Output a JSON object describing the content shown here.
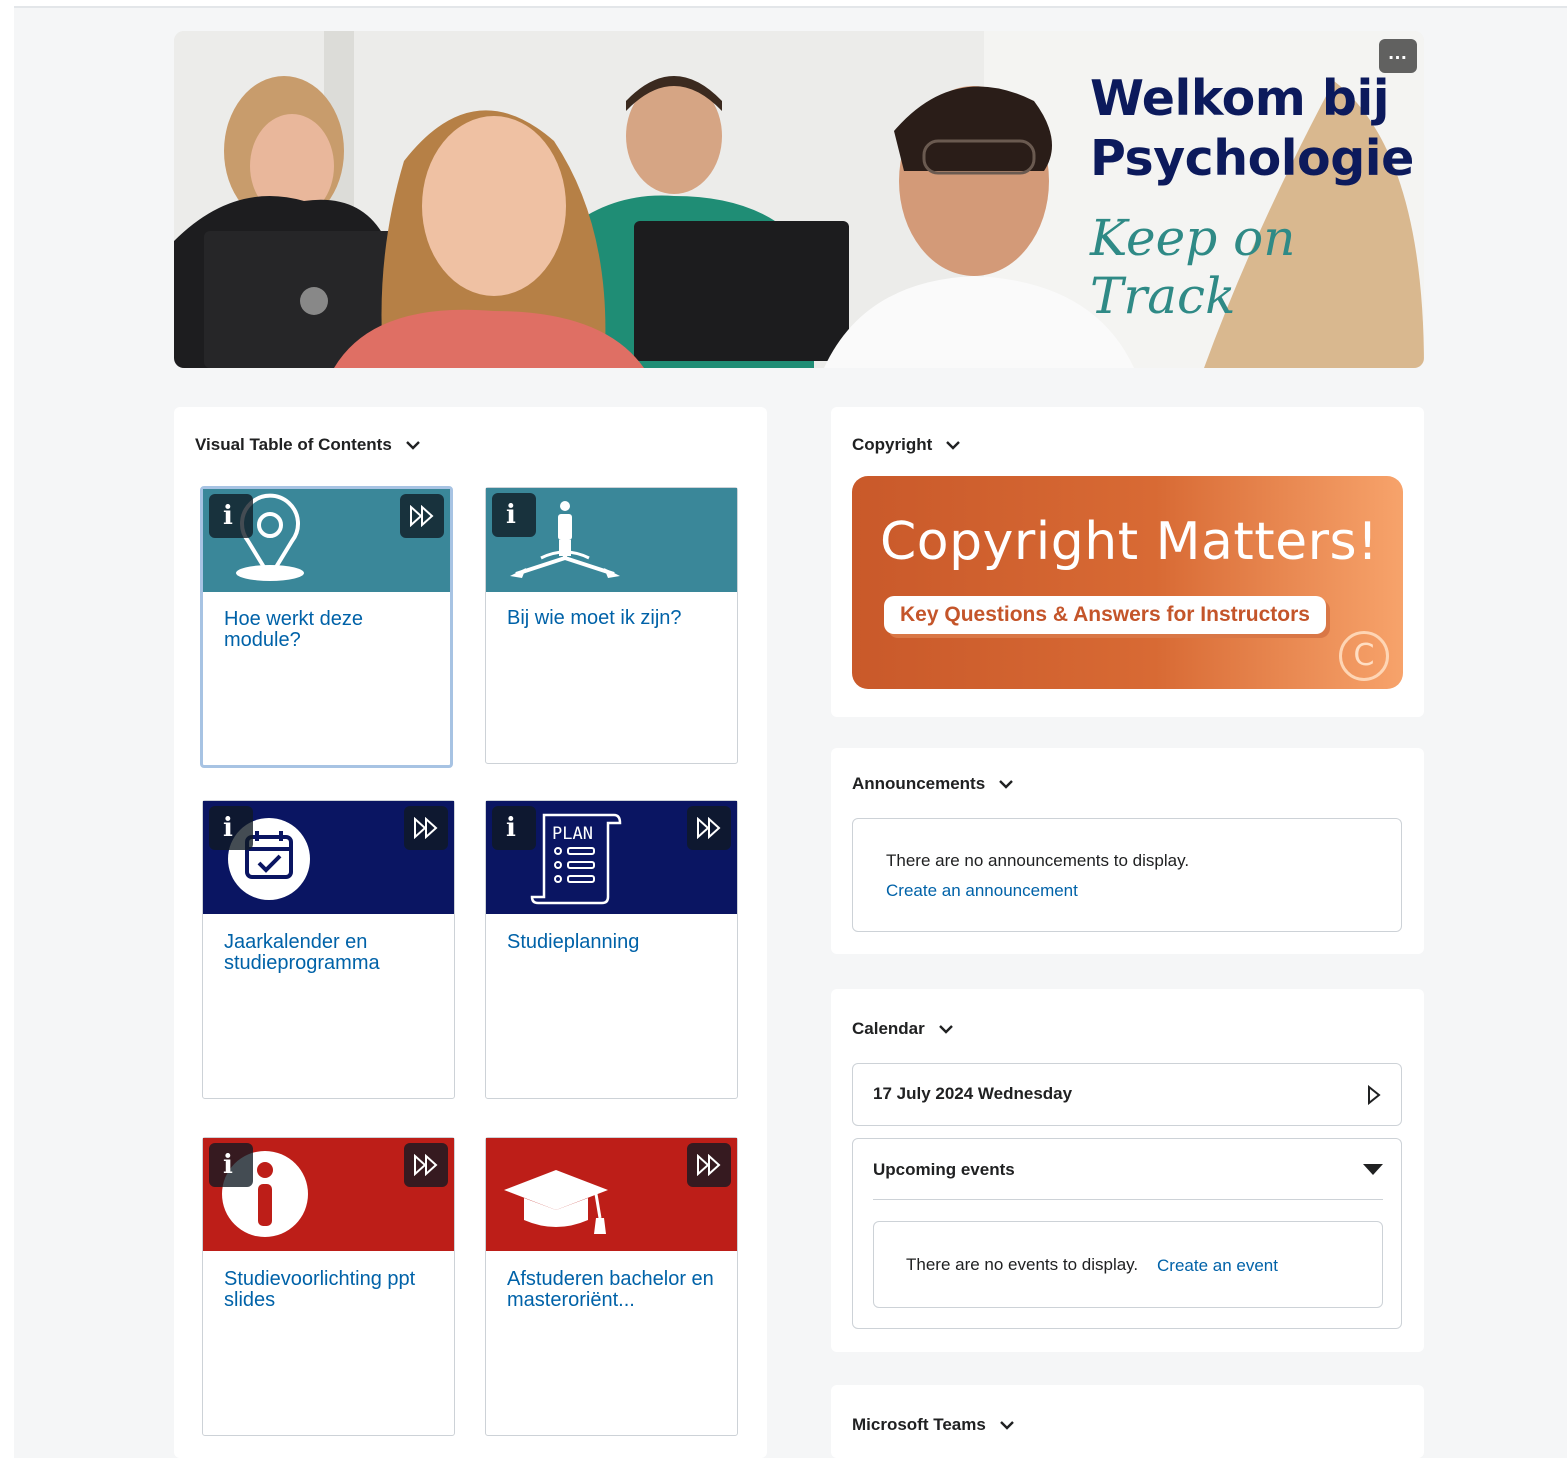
{
  "banner": {
    "title_line1": "Welkom bij",
    "title_line2": "Psychologie",
    "subtitle": "Keep on Track",
    "menu_label": "…"
  },
  "vtoc": {
    "title": "Visual Table of Contents",
    "info_label": "i",
    "tiles": [
      {
        "label": "Hoe werkt deze module?",
        "color": "#3a8799",
        "icon": "location-pin-icon"
      },
      {
        "label": "Bij wie moet ik zijn?",
        "color": "#3a8799",
        "icon": "person-crossroads-icon"
      },
      {
        "label": "Jaarkalender en studieprogramma",
        "color": "#0a1562",
        "icon": "calendar-check-icon"
      },
      {
        "label": "Studieplanning",
        "color": "#0a1562",
        "icon": "plan-scroll-icon"
      },
      {
        "label": "Studievoorlichting ppt slides",
        "color": "#bd1e18",
        "icon": "info-circle-icon"
      },
      {
        "label": "Afstuderen bachelor en masteroriënt...",
        "color": "#bd1e18",
        "icon": "graduation-cap-icon"
      }
    ]
  },
  "copyright": {
    "title": "Copyright",
    "banner_title": "Copyright Matters!",
    "banner_pill": "Key Questions & Answers for Instructors",
    "banner_symbol": "C"
  },
  "announcements": {
    "title": "Announcements",
    "empty_text": "There are no announcements to display.",
    "create_link": "Create an announcement"
  },
  "calendar": {
    "title": "Calendar",
    "date": "17 July 2024 Wednesday",
    "upcoming_label": "Upcoming events",
    "empty_text": "There are no events to display.",
    "create_link": "Create an event"
  },
  "teams": {
    "title": "Microsoft Teams"
  }
}
